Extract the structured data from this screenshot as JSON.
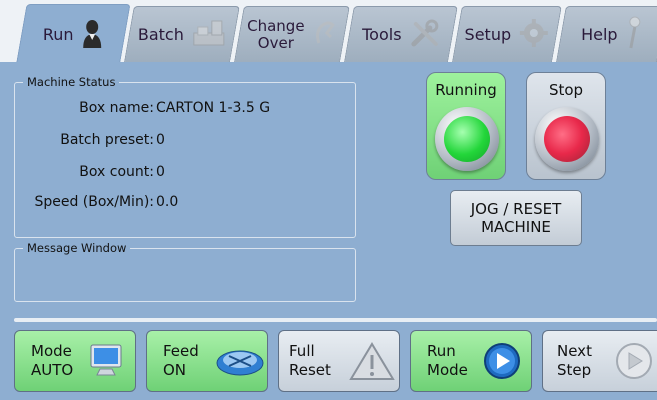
{
  "tabs": [
    {
      "label": "Run",
      "icon": "operator-icon",
      "active": true
    },
    {
      "label": "Batch",
      "icon": "batch-machine-icon",
      "active": false
    },
    {
      "label_line1": "Change",
      "label_line2": "Over",
      "icon": "changeover-icon",
      "active": false
    },
    {
      "label": "Tools",
      "icon": "tools-icon",
      "active": false
    },
    {
      "label": "Setup",
      "icon": "gear-icon",
      "active": false
    },
    {
      "label": "Help",
      "icon": "help-icon",
      "active": false
    }
  ],
  "machine_status": {
    "title": "Machine Status",
    "rows": [
      {
        "label": "Box name:",
        "value": "CARTON 1-3.5 G"
      },
      {
        "label": "Batch preset:",
        "value": "0"
      },
      {
        "label": "Box count:",
        "value": "0"
      },
      {
        "label": "Speed (Box/Min):",
        "value": "0.0"
      }
    ]
  },
  "message_window": {
    "title": "Message Window",
    "text": ""
  },
  "running_button": {
    "label": "Running",
    "lamp_color": "#23d63a"
  },
  "stop_button": {
    "label": "Stop",
    "lamp_color": "#e8284a"
  },
  "jog_reset": {
    "line1": "JOG / RESET",
    "line2": "MACHINE"
  },
  "bottom_buttons": [
    {
      "line1": "Mode",
      "line2": "AUTO",
      "icon": "monitor-icon",
      "style": "green"
    },
    {
      "line1": "Feed",
      "line2": "ON",
      "icon": "feeder-icon",
      "style": "green"
    },
    {
      "line1": "Full",
      "line2": "Reset",
      "icon": "warning-icon",
      "style": "gray"
    },
    {
      "line1": "Run",
      "line2": "Mode",
      "icon": "play-icon",
      "style": "green"
    },
    {
      "line1": "Next",
      "line2": "Step",
      "icon": "next-step-icon",
      "style": "gray"
    }
  ],
  "colors": {
    "panel": "#8eaed1",
    "green_button": "#7fdc85",
    "active_tab": "#8eaed1"
  }
}
